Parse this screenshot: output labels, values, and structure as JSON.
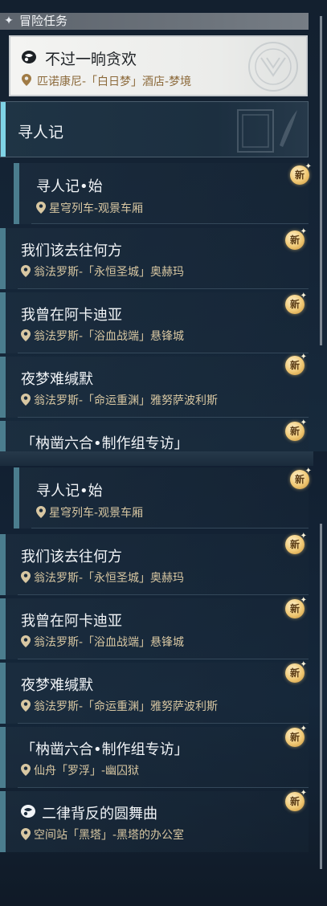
{
  "section": {
    "icon": "diamond-sparkle-icon",
    "title": "冒险任务"
  },
  "active_quest": {
    "icon": "mission-icon",
    "title": "不过一晌贪欢",
    "location": "匹诺康尼-「白日梦」酒店-梦境"
  },
  "chapter": {
    "title": "寻人记"
  },
  "quests_a": [
    {
      "title": "寻人记•始",
      "location": "星穹列车-观景车厢",
      "badge": "新"
    },
    {
      "title": "我们该去往何方",
      "location": "翁法罗斯-「永恒圣城」奥赫玛",
      "badge": "新"
    },
    {
      "title": "我曾在阿卡迪亚",
      "location": "翁法罗斯-「浴血战端」悬锋城",
      "badge": "新"
    },
    {
      "title": "夜梦难缄默",
      "location": "翁法罗斯-「命运重渊」雅努萨波利斯",
      "badge": "新"
    },
    {
      "title": "「枘凿六合•制作组专访」",
      "badge": "新"
    }
  ],
  "quests_b": [
    {
      "title": "寻人记•始",
      "location": "星穹列车-观景车厢",
      "badge": "新"
    },
    {
      "title": "我们该去往何方",
      "location": "翁法罗斯-「永恒圣城」奥赫玛",
      "badge": "新"
    },
    {
      "title": "我曾在阿卡迪亚",
      "location": "翁法罗斯-「浴血战端」悬锋城",
      "badge": "新"
    },
    {
      "title": "夜梦难缄默",
      "location": "翁法罗斯-「命运重渊」雅努萨波利斯",
      "badge": "新"
    },
    {
      "title": "「枘凿六合•制作组专访」",
      "location": "仙舟「罗浮」-幽囚狱",
      "badge": "新"
    },
    {
      "icon": "mission-icon",
      "title": "二律背反的圆舞曲",
      "location": "空间站「黑塔」-黑塔的办公室",
      "badge": "新"
    }
  ],
  "colors": {
    "accent_cyan": "#7fd3e6",
    "row_bar": "#4b7d8e",
    "badge_gold": "#f0c874",
    "location_text": "#d8c7a2"
  }
}
